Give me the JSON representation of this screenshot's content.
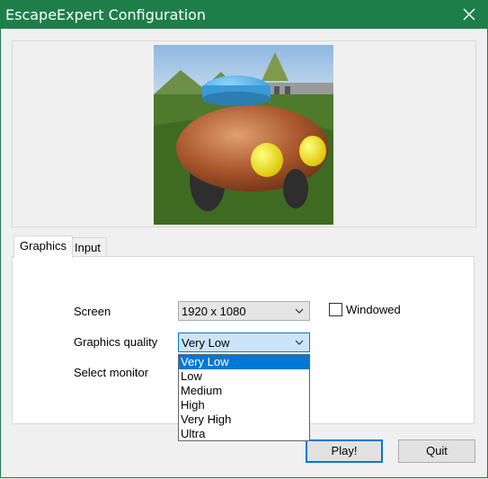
{
  "window": {
    "title": "EscapeExpert Configuration",
    "close_icon": "close-icon"
  },
  "tabs": [
    {
      "label": "Graphics",
      "active": true
    },
    {
      "label": "Input",
      "active": false
    }
  ],
  "graphics": {
    "screen_label": "Screen",
    "screen_value": "1920 x 1080",
    "windowed_label": "Windowed",
    "windowed_checked": false,
    "quality_label": "Graphics quality",
    "quality_value": "Very Low",
    "monitor_label": "Select monitor",
    "quality_options": [
      "Very Low",
      "Low",
      "Medium",
      "High",
      "Very High",
      "Ultra"
    ],
    "quality_selected_index": 0
  },
  "buttons": {
    "play": "Play!",
    "quit": "Quit"
  },
  "colors": {
    "titlebar": "#1e7e4a",
    "accent": "#0078d7"
  }
}
